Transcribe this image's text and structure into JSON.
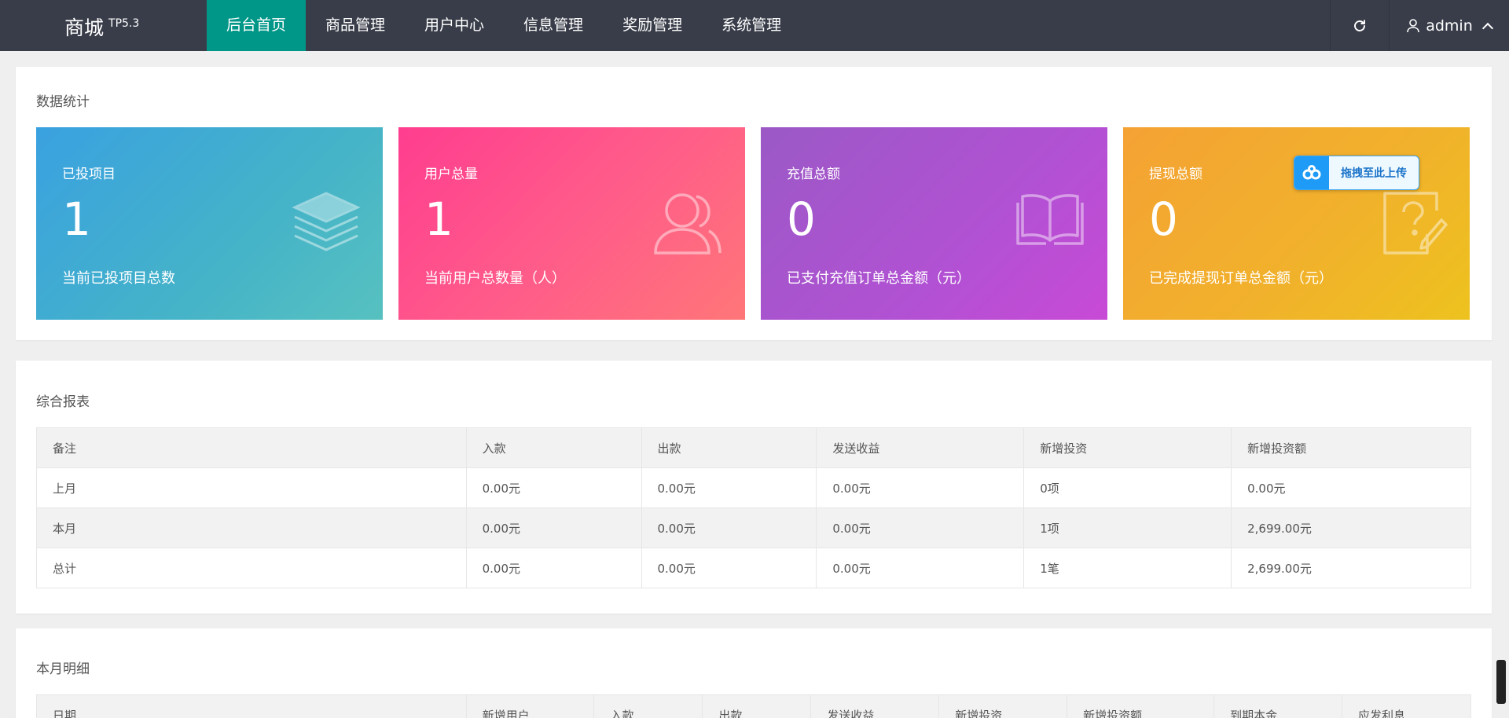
{
  "app": {
    "name": "商城",
    "version": "TP5.3"
  },
  "nav": {
    "items": [
      {
        "label": "后台首页"
      },
      {
        "label": "商品管理"
      },
      {
        "label": "用户中心"
      },
      {
        "label": "信息管理"
      },
      {
        "label": "奖励管理"
      },
      {
        "label": "系统管理"
      }
    ],
    "active_index": 0
  },
  "user": {
    "name": "admin"
  },
  "stats": {
    "title": "数据统计",
    "cards": [
      {
        "title": "已投项目",
        "value": "1",
        "desc": "当前已投项目总数",
        "icon": "layers-icon"
      },
      {
        "title": "用户总量",
        "value": "1",
        "desc": "当前用户总数量（人）",
        "icon": "users-icon"
      },
      {
        "title": "充值总额",
        "value": "0",
        "desc": "已支付充值订单总金额（元）",
        "icon": "book-icon"
      },
      {
        "title": "提现总额",
        "value": "0",
        "desc": "已完成提现订单总金额（元）",
        "icon": "edit-question-icon"
      }
    ]
  },
  "upload_badge": {
    "label": "拖拽至此上传",
    "icon": "baidu-cloud-icon"
  },
  "report": {
    "title": "综合报表",
    "columns": [
      "备注",
      "入款",
      "出款",
      "发送收益",
      "新增投资",
      "新增投资额"
    ],
    "rows": [
      [
        "上月",
        "0.00元",
        "0.00元",
        "0.00元",
        "0项",
        "0.00元"
      ],
      [
        "本月",
        "0.00元",
        "0.00元",
        "0.00元",
        "1项",
        "2,699.00元"
      ],
      [
        "总计",
        "0.00元",
        "0.00元",
        "0.00元",
        "1笔",
        "2,699.00元"
      ]
    ]
  },
  "monthly": {
    "title": "本月明细",
    "columns": [
      "日期",
      "新增用户",
      "入款",
      "出款",
      "发送收益",
      "新增投资",
      "新增投资额",
      "到期本金",
      "应发利息"
    ]
  },
  "colors": {
    "topbar": "#393d49",
    "nav_active": "#009688",
    "card1": "#45b3c8",
    "card2": "#ff5b8a",
    "card3": "#b151d3",
    "card4": "#f1b22b"
  }
}
